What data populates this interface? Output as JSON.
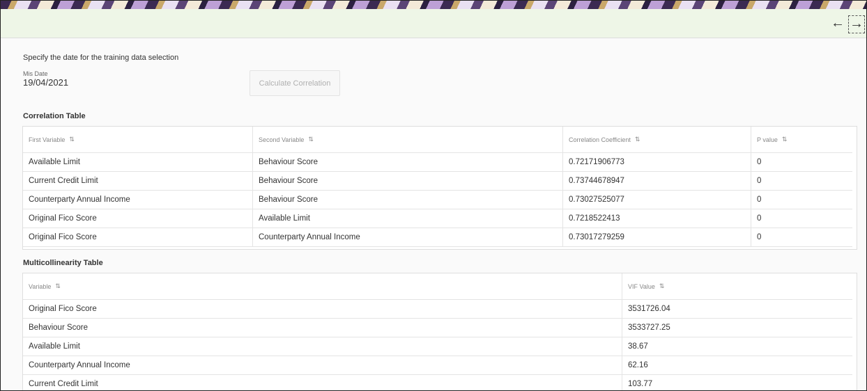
{
  "nav": {
    "prev_icon": "←",
    "next_icon": "→"
  },
  "form": {
    "instruction": "Specify the date for the training data selection",
    "mis_date_label": "Mis Date",
    "mis_date_value": "19/04/2021",
    "calculate_button": "Calculate Correlation"
  },
  "correlation": {
    "title": "Correlation Table",
    "columns": [
      "First Variable",
      "Second Variable",
      "Correlation Coefficient",
      "P value"
    ],
    "rows": [
      [
        "Available Limit",
        "Behaviour Score",
        "0.72171906773",
        "0"
      ],
      [
        "Current Credit Limit",
        "Behaviour Score",
        "0.73744678947",
        "0"
      ],
      [
        "Counterparty Annual Income",
        "Behaviour Score",
        "0.730275250​77",
        "0"
      ],
      [
        "Original Fico Score",
        "Available Limit",
        "0.7218522413",
        "0"
      ],
      [
        "Original Fico Score",
        "Counterparty Annual Income",
        "0.73017279259",
        "0"
      ]
    ]
  },
  "multicollinearity": {
    "title": "Multicollinearity Table",
    "columns": [
      "Variable",
      "VIF Value"
    ],
    "rows": [
      [
        "Original Fico Score",
        "3531726.04"
      ],
      [
        "Behaviour Score",
        "3533727.25"
      ],
      [
        "Available Limit",
        "38.67"
      ],
      [
        "Counterparty Annual Income",
        "62.16"
      ],
      [
        "Current Credit Limit",
        "103.77"
      ]
    ]
  },
  "sort_icon": "⇅"
}
